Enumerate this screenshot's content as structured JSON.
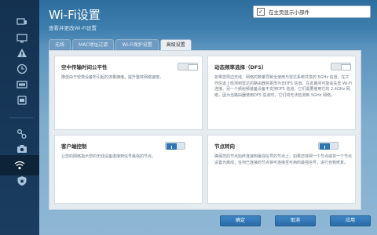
{
  "header": {
    "title": "Wi-Fi设置",
    "subtitle": "查看并更改Wi-Fi设置",
    "checkbox_label": "在主页显示小部件",
    "checkbox_checked": true
  },
  "tabs": [
    {
      "label": "无线",
      "active": false
    },
    {
      "label": "MAC地址过滤",
      "active": false
    },
    {
      "label": "Wi-Fi保护设置",
      "active": false
    },
    {
      "label": "高级设置",
      "active": true
    }
  ],
  "cards": [
    {
      "title": "空中传输时间公平性",
      "text": "降低由于较慢设备所引起的流量拥堵，提升整体网络速度。",
      "toggle": "off"
    },
    {
      "title": "动态频率选择（DFS）",
      "text": "如果您周边无线、网络的数量导致全使用与雷达系统共享的 5GHz 信道。在工作信道上检测到雷达的路由器将更改为非DFS 信道。在此期间可能会失去 Wi-Fi 连接。另一个频射频装备设备不支持DFS 信道。它们需要使用它的 2.4GHz 网络，因为当路由器使用DFS 信道时，它们将无法检测到 5GHz 网络。",
      "toggle": "off"
    },
    {
      "title": "客户端控制",
      "text": "让您的网络指示您的无线设备连接到信号最强的节点。",
      "toggle": "on"
    },
    {
      "title": "节点转向",
      "text": "确保您的节点始终连接到最强信号的节点上。如果您将网一个节点或将一个节点设置为离线，任何已连接的节点将可连接至可用的最强信号，进行自我修复。",
      "toggle": "on"
    }
  ],
  "footer": {
    "ok_label": "确定",
    "cancel_label": "取消",
    "apply_label": "应用"
  },
  "sidebar_icons": [
    "device-icon",
    "monitor-icon",
    "warning-icon",
    "clock-icon",
    "network-icon",
    "share-icon",
    "camera-icon",
    "wifi-settings-icon",
    "shield-icon"
  ]
}
